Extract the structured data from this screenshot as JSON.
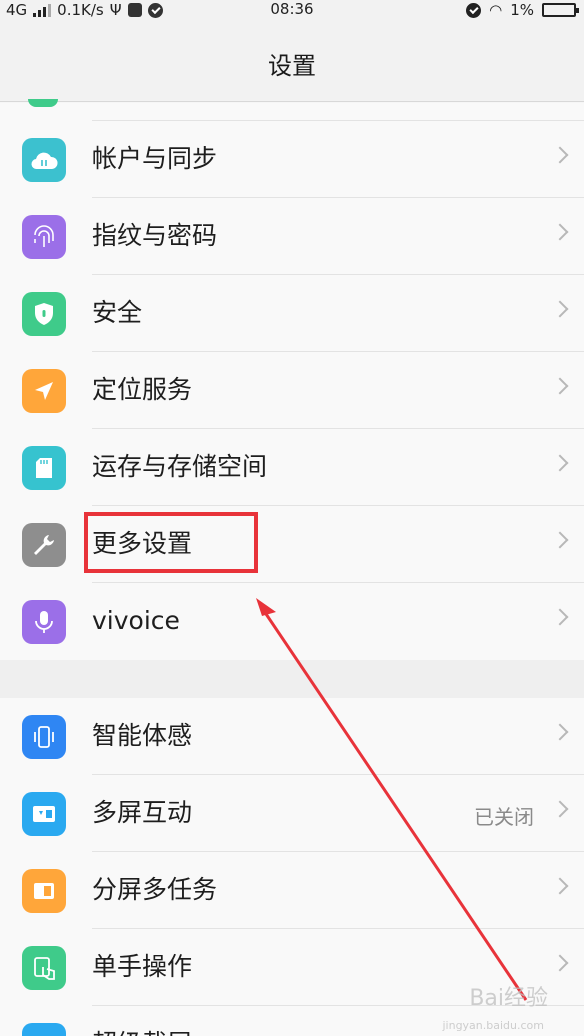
{
  "status_bar": {
    "network": "4G",
    "speed": "0.1K/s",
    "time": "08:36",
    "battery": "1%"
  },
  "header": {
    "title": "设置"
  },
  "group1": [
    {
      "label": "帐户与同步",
      "icon": "cloud-icon",
      "color": "#3cc1cf"
    },
    {
      "label": "指纹与密码",
      "icon": "fingerprint-icon",
      "color": "#9b6fe8"
    },
    {
      "label": "安全",
      "icon": "shield-icon",
      "color": "#3fcb8a"
    },
    {
      "label": "定位服务",
      "icon": "location-arrow-icon",
      "color": "#ffa63a"
    },
    {
      "label": "运存与存储空间",
      "icon": "sd-card-icon",
      "color": "#36c3cf"
    },
    {
      "label": "更多设置",
      "icon": "wrench-icon",
      "color": "#8e8e8e"
    },
    {
      "label": "vivoice",
      "icon": "microphone-icon",
      "color": "#9b6fe8"
    }
  ],
  "group2": [
    {
      "label": "智能体感",
      "icon": "phone-motion-icon",
      "color": "#2f86f3"
    },
    {
      "label": "多屏互动",
      "icon": "multi-screen-icon",
      "color": "#2aa9f0",
      "value": "已关闭"
    },
    {
      "label": "分屏多任务",
      "icon": "split-screen-icon",
      "color": "#ffa63a"
    },
    {
      "label": "单手操作",
      "icon": "one-hand-icon",
      "color": "#3fcb8a"
    },
    {
      "label": "超级截屏",
      "icon": "screenshot-icon",
      "color": "#2aa9f0"
    }
  ],
  "watermark": {
    "brand": "Bai经验",
    "url": "jingyan.baidu.com"
  }
}
